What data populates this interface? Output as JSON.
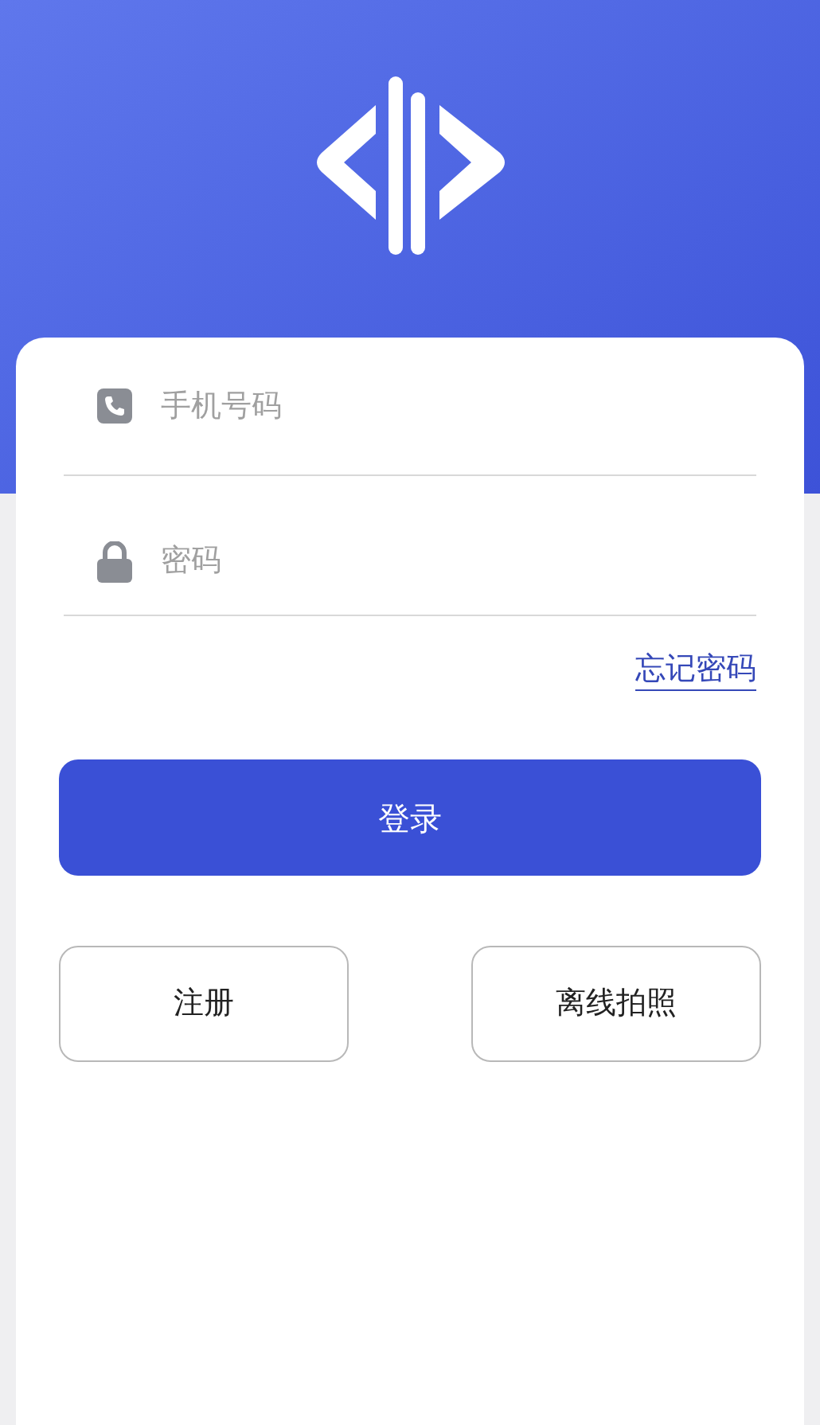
{
  "phone_field": {
    "placeholder": "手机号码"
  },
  "password_field": {
    "placeholder": "密码"
  },
  "forgot_link": "忘记密码",
  "login_button": "登录",
  "buttons": [
    {
      "label": "注册"
    },
    {
      "label": "离线拍照"
    }
  ]
}
